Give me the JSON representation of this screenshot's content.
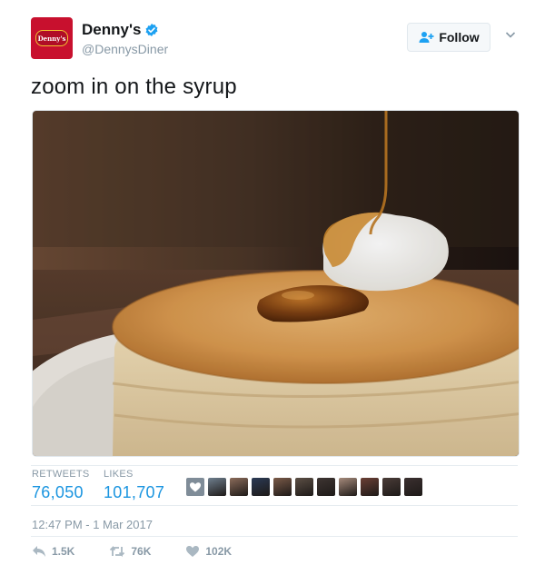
{
  "account": {
    "display_name": "Denny's",
    "handle": "@DennysDiner",
    "avatar_logo_text": "Denny's",
    "verified": true
  },
  "follow_button": {
    "label": "Follow",
    "icon": "add-user-icon"
  },
  "more_menu": {
    "icon": "chevron-down-icon"
  },
  "tweet": {
    "text": "zoom in on the syrup",
    "media": {
      "icon": "pancake-photo"
    }
  },
  "stats": {
    "retweets_label": "RETWEETS",
    "retweets_value": "76,050",
    "likes_label": "LIKES",
    "likes_value": "101,707",
    "liker_avatars": [
      "#6f7f8e",
      "#8a6b5a",
      "#2b3a55",
      "#7a5a48",
      "#5c4f45",
      "#3e3532",
      "#a58a7b",
      "#6b3f35",
      "#4a3c38",
      "#3b3030"
    ]
  },
  "timestamp": "12:47 PM - 1 Mar 2017",
  "actions": {
    "reply_count": "1.5K",
    "retweet_count": "76K",
    "like_count": "102K"
  },
  "colors": {
    "accent": "#1b95e0",
    "brand_red": "#c8102e",
    "muted": "#8899a6"
  }
}
